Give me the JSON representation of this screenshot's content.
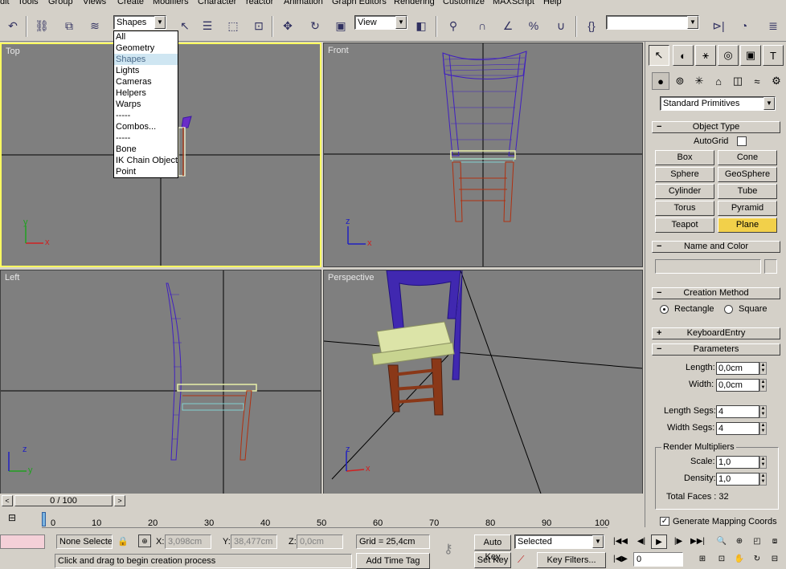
{
  "menu": [
    "dit",
    "Tools",
    "Group",
    "Views",
    "Create",
    "Modifiers",
    "Character",
    "reactor",
    "Animation",
    "Graph Editors",
    "Rendering",
    "Customize",
    "MAXScript",
    "Help"
  ],
  "toolbar": {
    "selection_filter": "Shapes",
    "ref_coord": "View",
    "named_selection": ""
  },
  "filter_dropdown": {
    "options": [
      "All",
      "Geometry",
      "Shapes",
      "Lights",
      "Cameras",
      "Helpers",
      "Warps",
      "-----",
      "Combos...",
      "-----",
      "Bone",
      "IK Chain Object",
      "Point"
    ],
    "selected": "Shapes"
  },
  "viewports": {
    "top": "Top",
    "front": "Front",
    "left": "Left",
    "perspective": "Perspective",
    "axis_x": "x",
    "axis_y": "y",
    "axis_z": "z"
  },
  "command_panel": {
    "category": "Standard Primitives",
    "object_type": {
      "title": "Object Type",
      "autogrid": "AutoGrid",
      "buttons": [
        "Box",
        "Cone",
        "Sphere",
        "GeoSphere",
        "Cylinder",
        "Tube",
        "Torus",
        "Pyramid",
        "Teapot",
        "Plane"
      ],
      "active": "Plane"
    },
    "name_color": {
      "title": "Name and Color",
      "name": ""
    },
    "creation_method": {
      "title": "Creation Method",
      "rectangle": "Rectangle",
      "square": "Square"
    },
    "keyboard_entry": "KeyboardEntry",
    "parameters": {
      "title": "Parameters",
      "length_label": "Length:",
      "length": "0,0cm",
      "width_label": "Width:",
      "width": "0,0cm",
      "length_segs_label": "Length Segs:",
      "length_segs": "4",
      "width_segs_label": "Width Segs:",
      "width_segs": "4",
      "render_multipliers": "Render Multipliers",
      "scale_label": "Scale:",
      "scale": "1,0",
      "density_label": "Density:",
      "density": "1,0",
      "total_faces": "Total Faces : 32",
      "gen_mapping": "Generate Mapping Coords"
    }
  },
  "time": {
    "slider": "0 / 100",
    "ticks": [
      "0",
      "10",
      "20",
      "30",
      "40",
      "50",
      "60",
      "70",
      "80",
      "90",
      "100"
    ],
    "slider_position": 0
  },
  "status": {
    "selection": "None Selecte",
    "x_label": "X:",
    "x": "3,098cm",
    "y_label": "Y:",
    "y": "38,477cm",
    "z_label": "Z:",
    "z": "0,0cm",
    "grid": "Grid = 25,4cm",
    "prompt": "Click and drag to begin creation process",
    "add_time_tag": "Add Time Tag",
    "auto_key": "Auto Key",
    "set_key": "Set Key",
    "key_mode": "Selected",
    "key_filters": "Key Filters...",
    "frame": "0"
  }
}
